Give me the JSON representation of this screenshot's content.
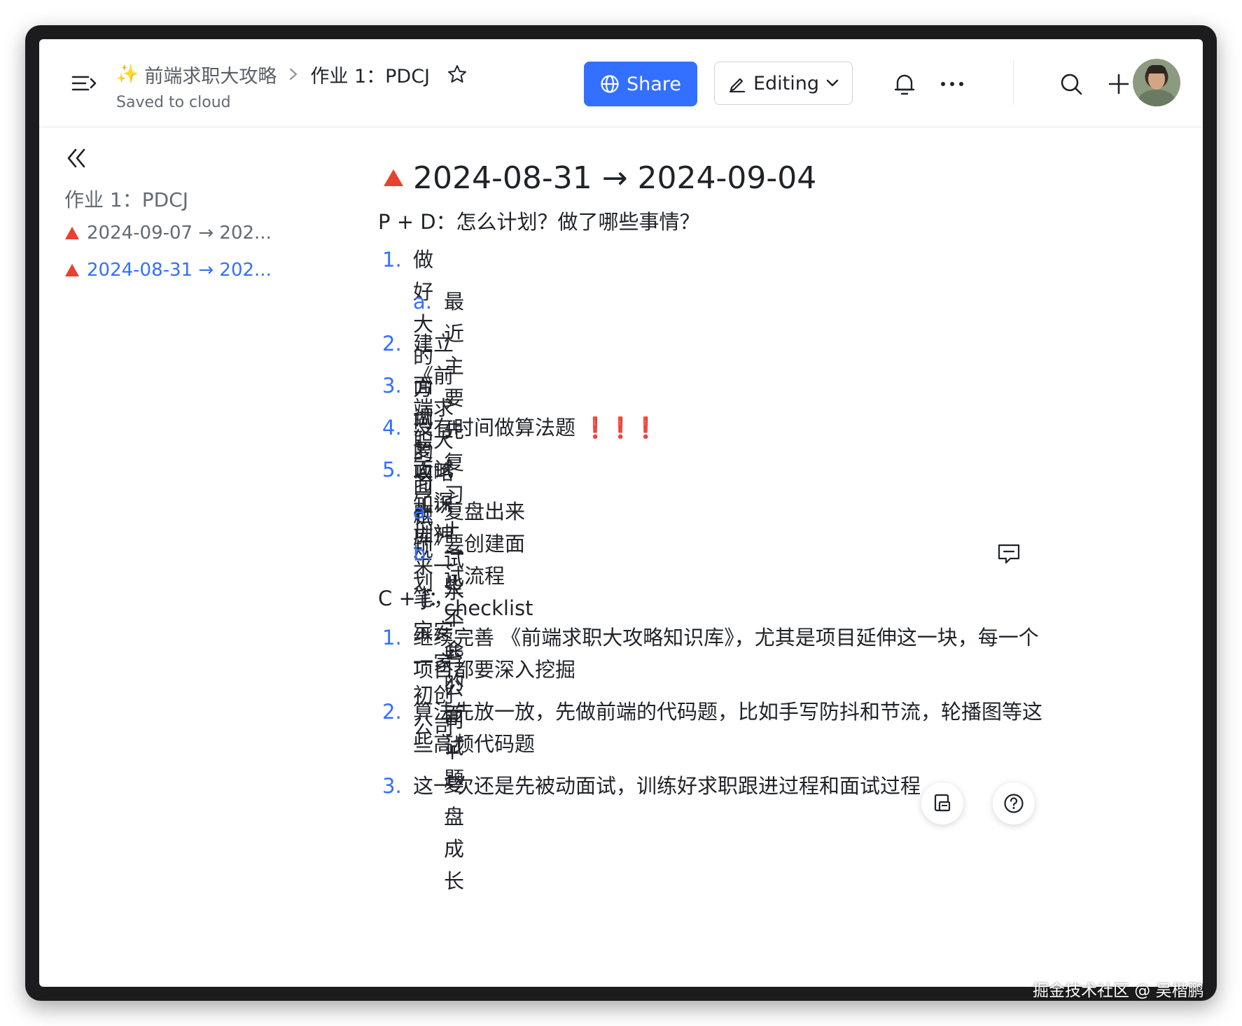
{
  "header": {
    "breadcrumb_parent": "前端求职大攻略",
    "breadcrumb_current": "作业 1：PDCJ",
    "saved_status": "Saved to cloud",
    "share_label": "Share",
    "editing_label": "Editing"
  },
  "sidebar": {
    "title": "作业 1：PDCJ",
    "items": [
      {
        "label": "2024-09-07 → 202..."
      },
      {
        "label": "2024-08-31 → 202..."
      }
    ]
  },
  "doc": {
    "heading": "2024-08-31 → 2024-09-04",
    "section1": "P + D：怎么计划？做了哪些事情？",
    "list1": [
      {
        "num": "1.",
        "text": "做好大的方向的面试规划"
      },
      {
        "num": "a.",
        "text": "最近主要先复习 + 试水一些公司 + 复盘成长"
      },
      {
        "num": "2.",
        "text": "建立《前端求职大攻略知识库》"
      },
      {
        "num": "3.",
        "text": "面试复习题"
      },
      {
        "num": "4.",
        "text": "没有时间做算法题",
        "extra": "❗❗❗"
      },
      {
        "num": "5.",
        "text": "面试了深圳神来一笔，宝安一家初创公司"
      },
      {
        "num": "a.",
        "text": "复盘出来要创建面试流程 checklist"
      },
      {
        "num": "b.",
        "text": "一些不会的面试题"
      }
    ],
    "section2": "C + J：",
    "list2": [
      {
        "num": "1.",
        "line1": "继续完善 《前端求职大攻略知识库》，尤其是项目延伸这一块，每一个",
        "line2": "项目都要深入挖掘"
      },
      {
        "num": "2.",
        "line1": "算法先放一放，先做前端的代码题，比如手写防抖和节流，轮播图等这",
        "line2": "些高频代码题"
      },
      {
        "num": "3.",
        "line1": "这一次还是先被动面试，训练好求职跟进过程和面试过程"
      }
    ]
  },
  "watermark": "掘金技术社区 @ 吴楷鹏",
  "colors": {
    "accent": "#3370ff",
    "triangle": "#e8412f",
    "text": "#1f2329",
    "muted": "#646a73"
  }
}
